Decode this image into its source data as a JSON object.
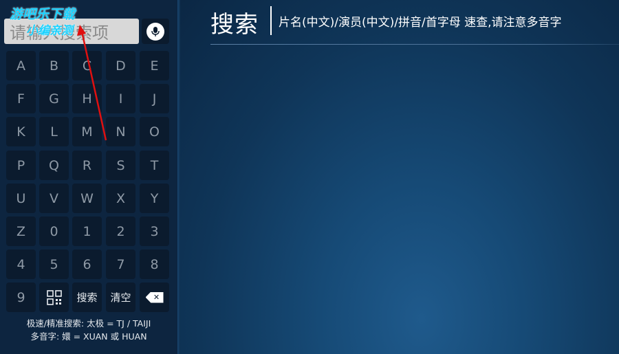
{
  "search": {
    "placeholder": "请输入搜索项"
  },
  "header": {
    "title": "搜索",
    "subtitle": "片名(中文)/演员(中文)/拼音/首字母 速查,请注意多音字"
  },
  "keyboard": {
    "rows": [
      [
        "A",
        "B",
        "C",
        "D",
        "E"
      ],
      [
        "F",
        "G",
        "H",
        "I",
        "J"
      ],
      [
        "K",
        "L",
        "M",
        "N",
        "O"
      ],
      [
        "P",
        "Q",
        "R",
        "S",
        "T"
      ],
      [
        "U",
        "V",
        "W",
        "X",
        "Y"
      ],
      [
        "Z",
        "0",
        "1",
        "2",
        "3"
      ],
      [
        "4",
        "5",
        "6",
        "7",
        "8"
      ]
    ],
    "bottom_row": {
      "digit": "9",
      "qr_icon": "qr-code-icon",
      "search_label": "搜索",
      "clear_label": "清空",
      "backspace_icon": "backspace-icon"
    }
  },
  "hints": {
    "line1": "极速/精准搜索: 太极 = TJ / TAIJI",
    "line2": "多音字: 嬛 = XUAN 或 HUAN"
  },
  "watermark": {
    "line1": "游吧乐下载",
    "line2": "小编亲测"
  },
  "colors": {
    "key_bg": "#0b1b2e",
    "panel_bg": "#0d2540",
    "watermark": "#19d2ff",
    "annotation_arrow": "#e01010"
  }
}
